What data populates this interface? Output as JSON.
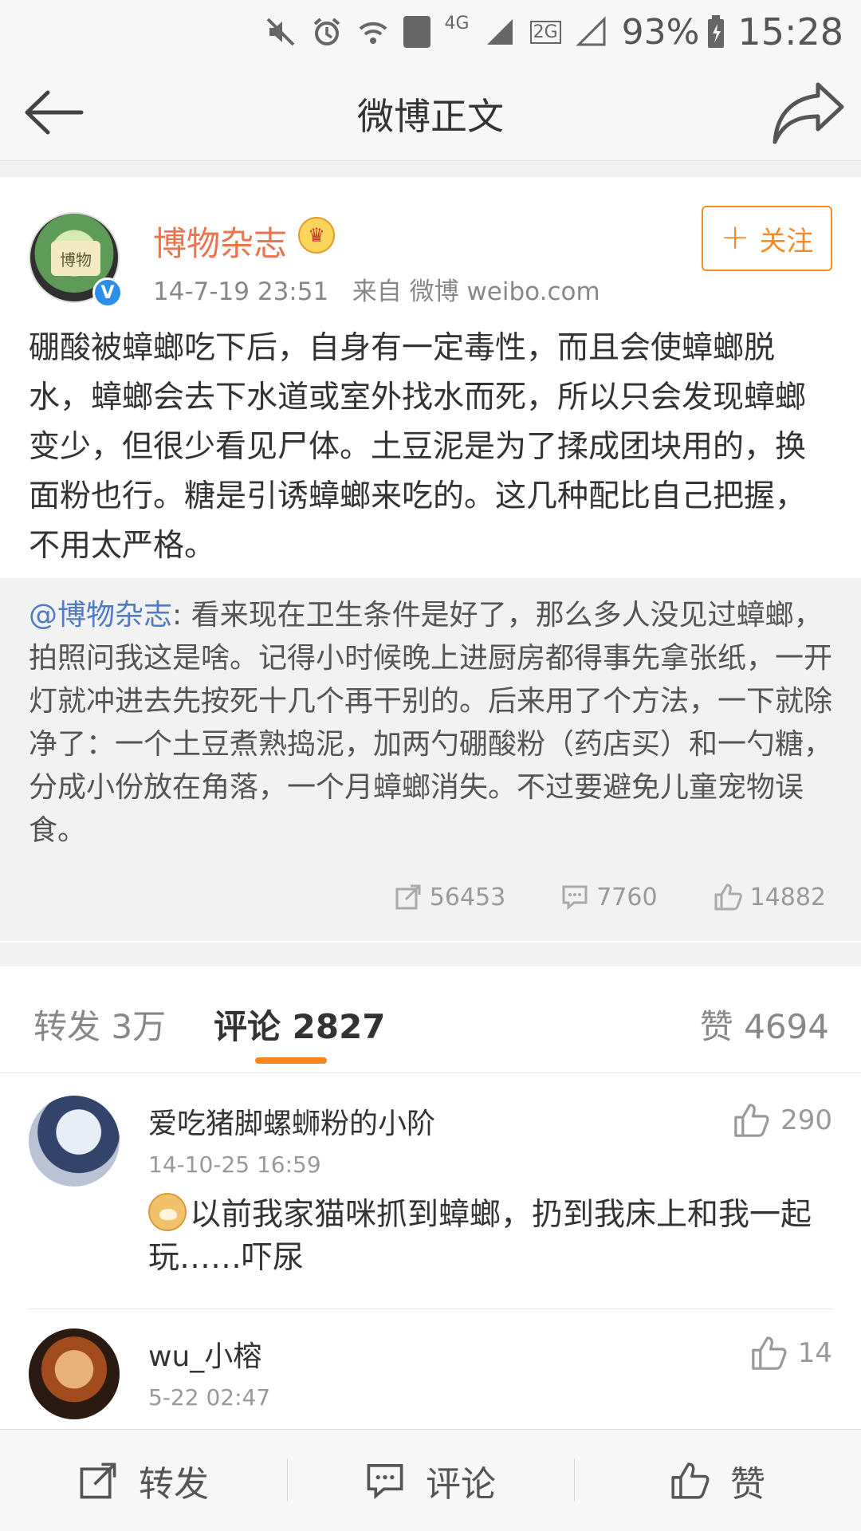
{
  "status_bar": {
    "sim_badge": "2",
    "network_4g": "4G",
    "network_2g": "2G",
    "battery": "93%",
    "time": "15:28",
    "icons": [
      "mute-icon",
      "alarm-icon",
      "wifi-icon",
      "signal-icon",
      "battery-icon"
    ]
  },
  "nav": {
    "title": "微博正文",
    "back_icon": "back-arrow-icon",
    "share_icon": "share-forward-icon"
  },
  "post": {
    "username": "博物杂志",
    "avatar_text": "博物",
    "verified_badge": "V",
    "timestamp": "14-7-19 23:51",
    "source": "来自 微博 weibo.com",
    "follow_label": "关注",
    "body": "硼酸被蟑螂吃下后，自身有一定毒性，而且会使蟑螂脱水，蟑螂会去下水道或室外找水而死，所以只会发现蟑螂变少，但很少看见尸体。土豆泥是为了揉成团块用的，换面粉也行。糖是引诱蟑螂来吃的。这几种配比自己把握，不用太严格。",
    "retweet": {
      "mention": "@博物杂志",
      "text": ": 看来现在卫生条件是好了，那么多人没见过蟑螂，拍照问我这是啥。记得小时候晚上进厨房都得事先拿张纸，一开灯就冲进去先按死十几个再干别的。后来用了个方法，一下就除净了：一个土豆煮熟捣泥，加两勺硼酸粉（药店买）和一勺糖，分成小份放在角落，一个月蟑螂消失。不过要避免儿童宠物误食。",
      "reposts": "56453",
      "comments": "7760",
      "likes": "14882"
    }
  },
  "tabs": {
    "repost": "转发 3万",
    "comment": "评论 2827",
    "like": "赞 4694"
  },
  "comments": [
    {
      "name": "爱吃猪脚螺蛳粉的小阶",
      "time": "14-10-25 16:59",
      "likes": "290",
      "text": "以前我家猫咪抓到蟑螂，扔到我床上和我一起玩……吓尿"
    },
    {
      "name": "wu_小榕",
      "time": "5-22 02:47",
      "likes": "14",
      "text": ""
    }
  ],
  "actions": {
    "repost": "转发",
    "comment": "评论",
    "like": "赞"
  },
  "colors": {
    "accent_orange": "#f7861e",
    "username_orange": "#eb7350",
    "mention_blue": "#4f7cc3",
    "verified_blue": "#2c8ee8"
  }
}
